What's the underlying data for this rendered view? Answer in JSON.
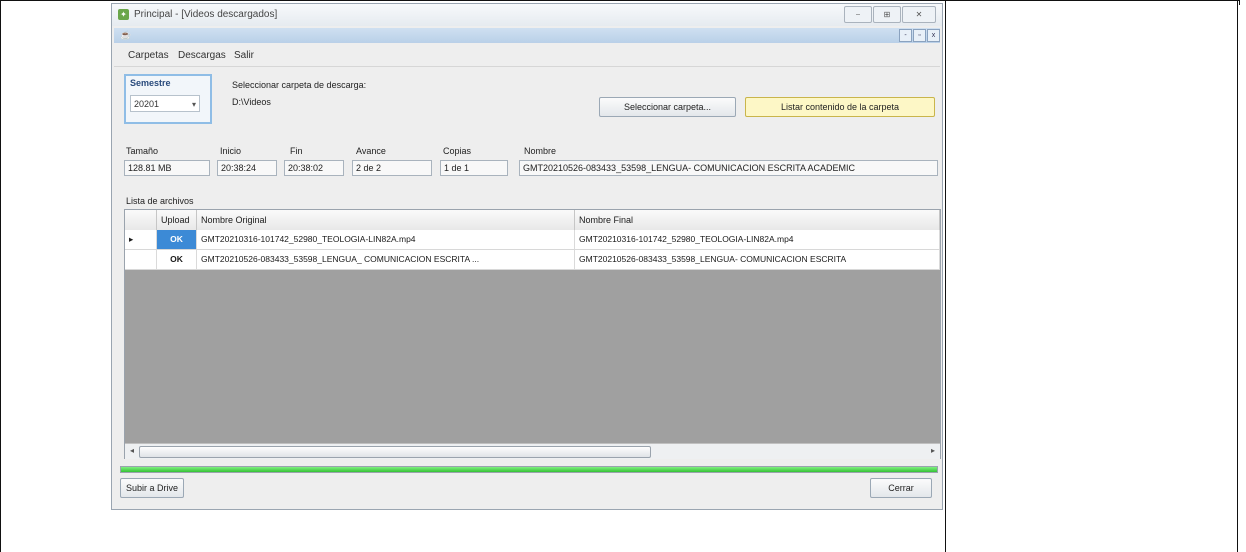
{
  "window": {
    "title": "Principal - [Videos descargados]",
    "buttons": [
      "⎯",
      "⊞",
      "✕"
    ]
  },
  "inner_window": {
    "buttons": [
      "-",
      "▫",
      "x"
    ]
  },
  "menu": [
    "Carpetas",
    "Descargas",
    "Salir"
  ],
  "semestre": {
    "label": "Semestre",
    "value": "20201"
  },
  "download_folder": {
    "label": "Seleccionar carpeta de descarga:",
    "path": "D:\\Videos"
  },
  "buttons": {
    "select_folder": "Seleccionar carpeta...",
    "list_contents": "Listar contenido de la carpeta",
    "upload_drive": "Subir a Drive",
    "close": "Cerrar"
  },
  "status_fields": {
    "tamano": {
      "label": "Tamaño",
      "value": "128.81 MB"
    },
    "inicio": {
      "label": "Inicio",
      "value": "20:38:24"
    },
    "fin": {
      "label": "Fin",
      "value": "20:38:02"
    },
    "avance": {
      "label": "Avance",
      "value": "2 de 2"
    },
    "copias": {
      "label": "Copias",
      "value": "1 de 1"
    },
    "nombre": {
      "label": "Nombre",
      "value": "GMT20210526-083433_53598_LENGUA- COMUNICACION ESCRITA ACADEMIC"
    }
  },
  "list": {
    "label": "Lista de archivos",
    "columns": [
      "",
      "Upload",
      "Nombre Original",
      "Nombre Final"
    ],
    "rows": [
      {
        "marker": "▸",
        "upload": "OK",
        "original": "GMT20210316-101742_52980_TEOLOGIA-LIN82A.mp4",
        "final": "GMT20210316-101742_52980_TEOLOGIA-LIN82A.mp4"
      },
      {
        "marker": "",
        "upload": "OK",
        "original": "GMT20210526-083433_53598_LENGUA_ COMUNICACION ESCRITA ...",
        "final": "GMT20210526-083433_53598_LENGUA- COMUNICACION ESCRITA"
      }
    ]
  },
  "progress": 1.0
}
